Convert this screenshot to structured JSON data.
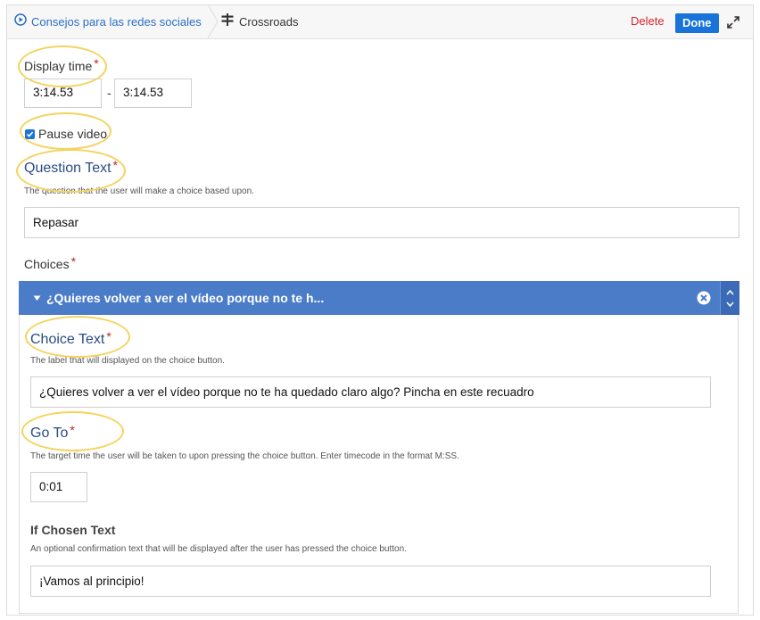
{
  "breadcrumb": {
    "parent_label": "Consejos para las redes sociales",
    "current_label": "Crossroads"
  },
  "toolbar": {
    "delete_label": "Delete",
    "done_label": "Done"
  },
  "display_time": {
    "label": "Display time",
    "required_mark": "*",
    "start_value": "3:14.53",
    "separator": "-",
    "end_value": "3:14.53"
  },
  "pause_video": {
    "label": "Pause video",
    "checked": true
  },
  "question_text": {
    "label": "Question Text",
    "required_mark": "*",
    "description": "The question that the user will make a choice based upon.",
    "value": "Repasar"
  },
  "choices": {
    "label": "Choices",
    "required_mark": "*",
    "items": [
      {
        "header_title": "¿Quieres volver a ver el vídeo porque no te h...",
        "choice_text": {
          "label": "Choice Text",
          "required_mark": "*",
          "description": "The label that will displayed on the choice button.",
          "value": "¿Quieres volver a ver el vídeo porque no te ha quedado claro algo? Pincha en este recuadro"
        },
        "go_to": {
          "label": "Go To",
          "required_mark": "*",
          "description": "The target time the user will be taken to upon pressing the choice button. Enter timecode in the format M:SS.",
          "value": "0:01"
        },
        "if_chosen_text": {
          "label": "If Chosen Text",
          "description": "An optional confirmation text that will be displayed after the user has pressed the choice button.",
          "value": "¡Vamos al principio!"
        }
      }
    ]
  },
  "colors": {
    "accent_blue": "#1a73d9",
    "choice_header": "#4a7cc8",
    "delete_red": "#d9262c",
    "highlight_yellow": "#f4d35e"
  },
  "icons": [
    "play-circle-icon",
    "signpost-icon",
    "expand-icon",
    "caret-down-icon",
    "remove-circle-icon",
    "reorder-arrows-icon",
    "checkbox-checked-icon"
  ]
}
